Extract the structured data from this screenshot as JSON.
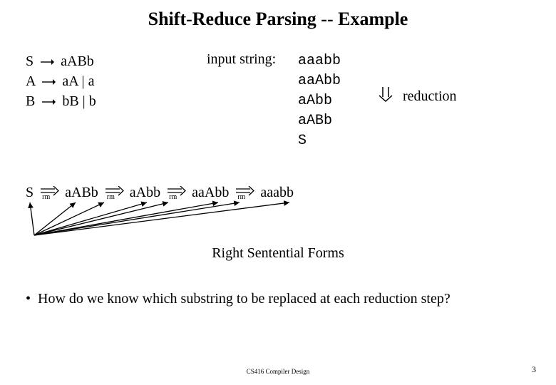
{
  "title": "Shift-Reduce Parsing -- Example",
  "grammar": {
    "rules": [
      {
        "lhs": "S",
        "rhs": "aABb"
      },
      {
        "lhs": "A",
        "rhs": "aA  |  a"
      },
      {
        "lhs": "B",
        "rhs": "bB  | b"
      }
    ]
  },
  "input_label": "input string:",
  "derivations": [
    "aaabb",
    "aaAbb",
    "aAbb",
    "aABb",
    "S"
  ],
  "reduction_label": "reduction",
  "chain": {
    "steps": [
      "S",
      "aABb",
      "aAbb",
      "aaAbb",
      "aaabb"
    ],
    "sub": "rm"
  },
  "rsf_label": "Right Sentential Forms",
  "bullet": "How do we know which substring to be replaced at each reduction step?",
  "footer_center": "CS416 Compiler Design",
  "footer_right": "3"
}
